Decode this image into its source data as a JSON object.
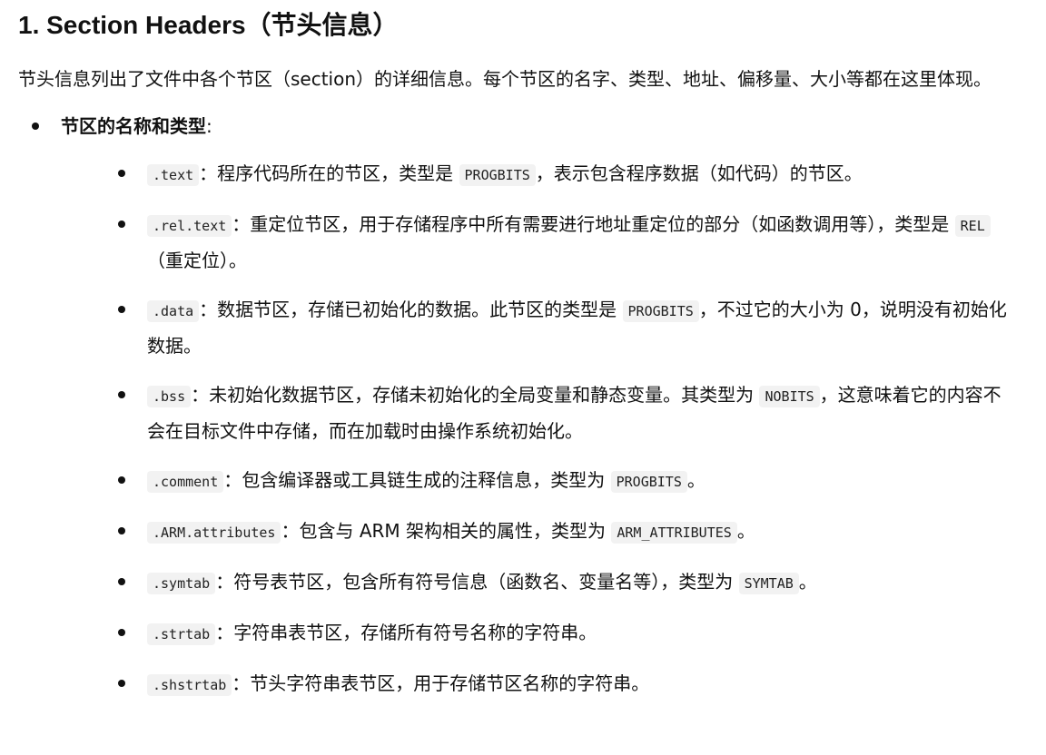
{
  "title": "1. Section Headers（节头信息）",
  "intro": "节头信息列出了文件中各个节区（section）的详细信息。每个节区的名字、类型、地址、偏移量、大小等都在这里体现。",
  "topic": {
    "label": "节区的名称和类型",
    "colon": ":"
  },
  "sections": [
    {
      "name": ".text",
      "parts": [
        "：程序代码所在的节区，类型是 ",
        "，表示包含程序数据（如代码）的节区。"
      ],
      "type": "PROGBITS"
    },
    {
      "name": ".rel.text",
      "parts": [
        "：重定位节区，用于存储程序中所有需要进行地址重定位的部分（如函数调用等），类型是 ",
        "（重定位）。"
      ],
      "type": "REL"
    },
    {
      "name": ".data",
      "parts": [
        "：数据节区，存储已初始化的数据。此节区的类型是 ",
        "，不过它的大小为 0，说明没有初始化数据。"
      ],
      "type": "PROGBITS"
    },
    {
      "name": ".bss",
      "parts": [
        "：未初始化数据节区，存储未初始化的全局变量和静态变量。其类型为 ",
        "，这意味着它的内容不会在目标文件中存储，而在加载时由操作系统初始化。"
      ],
      "type": "NOBITS"
    },
    {
      "name": ".comment",
      "parts": [
        "：包含编译器或工具链生成的注释信息，类型为 ",
        "。"
      ],
      "type": "PROGBITS"
    },
    {
      "name": ".ARM.attributes",
      "parts": [
        "：包含与 ARM 架构相关的属性，类型为 ",
        "。"
      ],
      "type": "ARM_ATTRIBUTES"
    },
    {
      "name": ".symtab",
      "parts": [
        "：符号表节区，包含所有符号信息（函数名、变量名等），类型为 ",
        "。"
      ],
      "type": "SYMTAB"
    },
    {
      "name": ".strtab",
      "parts": [
        "：字符串表节区，存储所有符号名称的字符串。",
        ""
      ],
      "type": ""
    },
    {
      "name": ".shstrtab",
      "parts": [
        "：节头字符串表节区，用于存储节区名称的字符串。",
        ""
      ],
      "type": ""
    }
  ]
}
